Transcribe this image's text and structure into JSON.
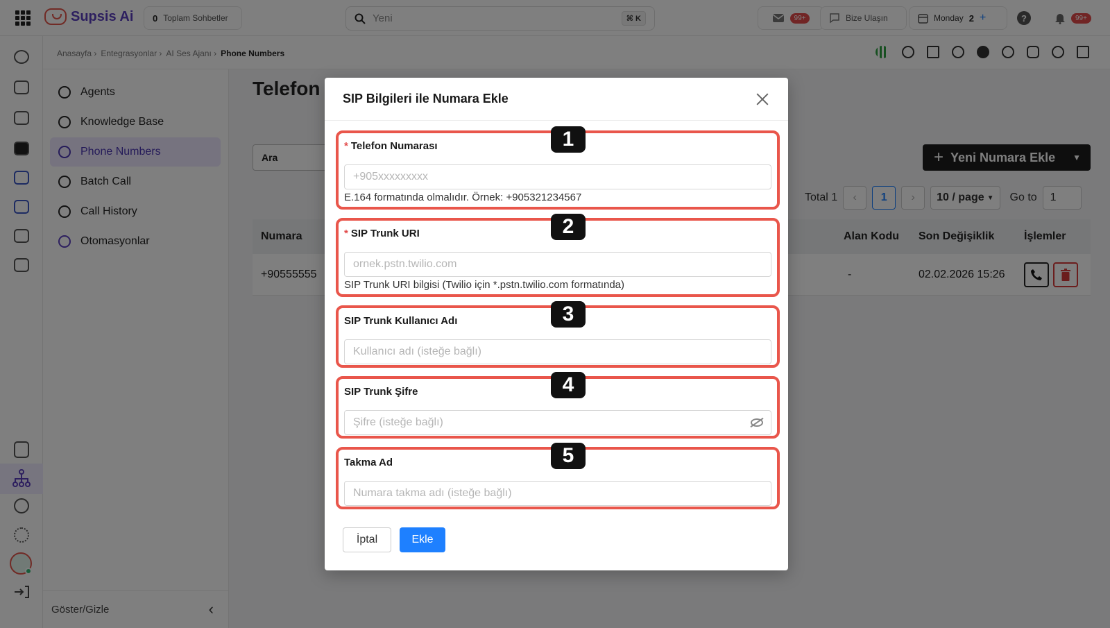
{
  "header": {
    "app_name": "Supsis Ai",
    "conversations_count": "0",
    "conversations_label": "Toplam Sohbetler",
    "search_placeholder": "Yeni",
    "search_shortcut": "⌘ K",
    "mail_badge": "99+",
    "contact_label": "Bize Ulaşın",
    "calendar_day": "Monday",
    "calendar_count": "2",
    "notification_badge": "99+"
  },
  "breadcrumb": {
    "items": [
      "Anasayfa ›",
      "Entegrasyonlar ›",
      "AI Ses Ajanı ›",
      "Phone Numbers"
    ]
  },
  "sidebar": {
    "items": [
      {
        "label": "Agents"
      },
      {
        "label": "Knowledge Base"
      },
      {
        "label": "Phone Numbers"
      },
      {
        "label": "Batch Call"
      },
      {
        "label": "Call History"
      },
      {
        "label": "Otomasyonlar"
      }
    ],
    "footer_label": "Göster/Gizle"
  },
  "main": {
    "title": "Telefon",
    "search_label": "Ara",
    "new_button": "Yeni Numara Ekle",
    "pagination": {
      "total": "Total 1",
      "current_page": "1",
      "page_size": "10 / page",
      "goto_label": "Go to",
      "goto_value": "1"
    },
    "table": {
      "headers": [
        "Numara",
        "Alan Kodu",
        "Son Değişiklik",
        "İşlemler"
      ],
      "rows": [
        {
          "numara": "+90555555",
          "alan_kodu": "-",
          "son_degisiklik": "02.02.2026 15:26"
        }
      ]
    }
  },
  "modal": {
    "title": "SIP Bilgileri ile Numara Ekle",
    "fields": [
      {
        "badge": "1",
        "label": "Telefon Numarası",
        "required": "*",
        "placeholder": "+905xxxxxxxxx",
        "help": "E.164 formatında olmalıdır. Örnek: +905321234567"
      },
      {
        "badge": "2",
        "label": "SIP Trunk URI",
        "required": "*",
        "placeholder": "ornek.pstn.twilio.com",
        "help": "SIP Trunk URI bilgisi (Twilio için *.pstn.twilio.com formatında)"
      },
      {
        "badge": "3",
        "label": "SIP Trunk Kullanıcı Adı",
        "placeholder": "Kullanıcı adı (isteğe bağlı)"
      },
      {
        "badge": "4",
        "label": "SIP Trunk Şifre",
        "placeholder": "Şifre (isteğe bağlı)"
      },
      {
        "badge": "5",
        "label": "Takma Ad",
        "placeholder": "Numara takma adı (isteğe bağlı)"
      }
    ],
    "cancel_label": "İptal",
    "submit_label": "Ekle"
  },
  "colors": {
    "accent": "#1e80ff",
    "highlight": "#e9564b",
    "brand": "#5a3fbf",
    "active_nav": "#ece6ff"
  }
}
